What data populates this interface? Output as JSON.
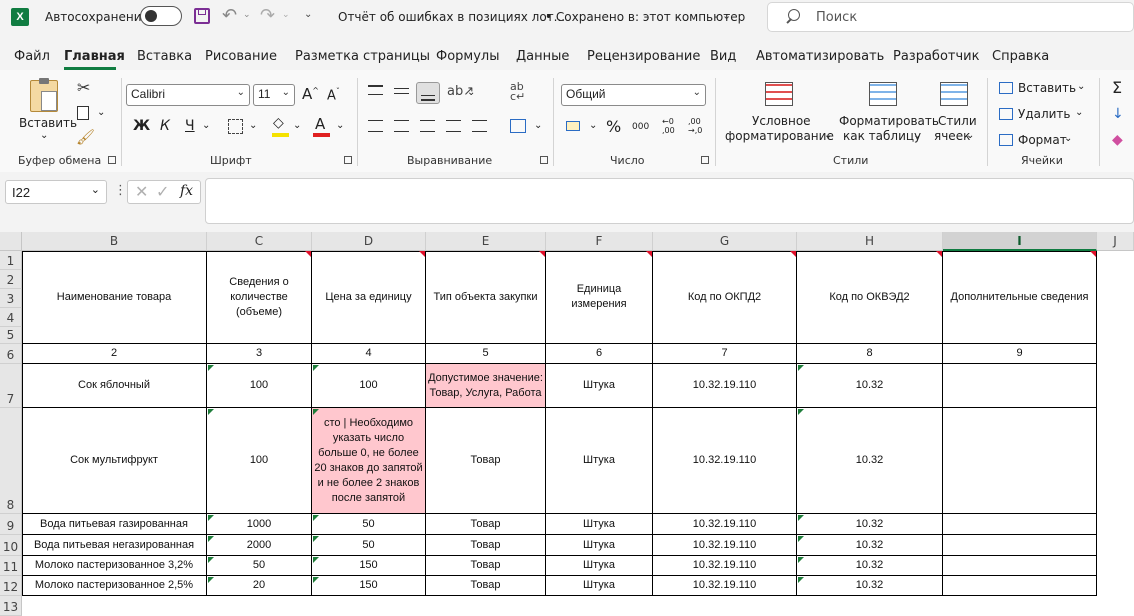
{
  "titlebar": {
    "autosave_label": "Автосохранение",
    "doc_title": "Отчёт об ошибках в позициях лот...",
    "saved_status": "• Сохранено в: этот компьютер",
    "search_placeholder": "Поиск"
  },
  "menu": [
    "Файл",
    "Главная",
    "Вставка",
    "Рисование",
    "Разметка страницы",
    "Формулы",
    "Данные",
    "Рецензирование",
    "Вид",
    "Автоматизировать",
    "Разработчик",
    "Справка"
  ],
  "ribbon": {
    "paste_label": "Вставить",
    "clipboard_group": "Буфер обмена",
    "font_name": "Calibri",
    "font_size": "11",
    "bold": "Ж",
    "italic": "К",
    "underline": "Ч",
    "font_group": "Шрифт",
    "align_group": "Выравнивание",
    "number_format": "Общий",
    "number_group": "Число",
    "cond_format_1": "Условное",
    "cond_format_2": "форматирование",
    "format_table_1": "Форматировать",
    "format_table_2": "как таблицу",
    "cell_styles_1": "Стили",
    "cell_styles_2": "ячеек",
    "styles_group": "Стили",
    "insert_label": "Вставить",
    "delete_label": "Удалить",
    "format_label": "Формат",
    "cells_group": "Ячейки"
  },
  "formula_bar": {
    "name_box": "I22",
    "fx": "fx"
  },
  "columns": [
    "B",
    "C",
    "D",
    "E",
    "F",
    "G",
    "H",
    "I",
    "J"
  ],
  "rows": [
    "1",
    "2",
    "3",
    "4",
    "5",
    "6",
    "7",
    "8",
    "9",
    "10",
    "11",
    "12",
    "13"
  ],
  "header_row": [
    "Наименование товара",
    "Сведения о количестве (объеме)",
    "Цена за единицу",
    "Тип объекта закупки",
    "Единица измерения",
    "Код по ОКПД2",
    "Код по ОКВЭД2",
    "Дополнительные сведения"
  ],
  "num_row": [
    "2",
    "3",
    "4",
    "5",
    "6",
    "7",
    "8",
    "9"
  ],
  "data_rows": [
    [
      "Сок яблочный",
      "100",
      "100",
      "Допустимое значение: Товар, Услуга, Работа",
      "Штука",
      "10.32.19.110",
      "10.32",
      ""
    ],
    [
      "Сок мультифрукт",
      "100",
      "сто | Необходимо указать число больше 0, не более 20 знаков до запятой и не более 2 знаков после запятой",
      "Товар",
      "Штука",
      "10.32.19.110",
      "10.32",
      ""
    ],
    [
      "Вода питьевая газированная",
      "1000",
      "50",
      "Товар",
      "Штука",
      "10.32.19.110",
      "10.32",
      ""
    ],
    [
      "Вода питьевая негазированная",
      "2000",
      "50",
      "Товар",
      "Штука",
      "10.32.19.110",
      "10.32",
      ""
    ],
    [
      "Молоко пастеризованное 3,2%",
      "50",
      "150",
      "Товар",
      "Штука",
      "10.32.19.110",
      "10.32",
      ""
    ],
    [
      "Молоко пастеризованное 2,5%",
      "20",
      "150",
      "Товар",
      "Штука",
      "10.32.19.110",
      "10.32",
      ""
    ]
  ],
  "colors": {
    "accent": "#107c41",
    "error_fill": "#ffc7ce"
  }
}
